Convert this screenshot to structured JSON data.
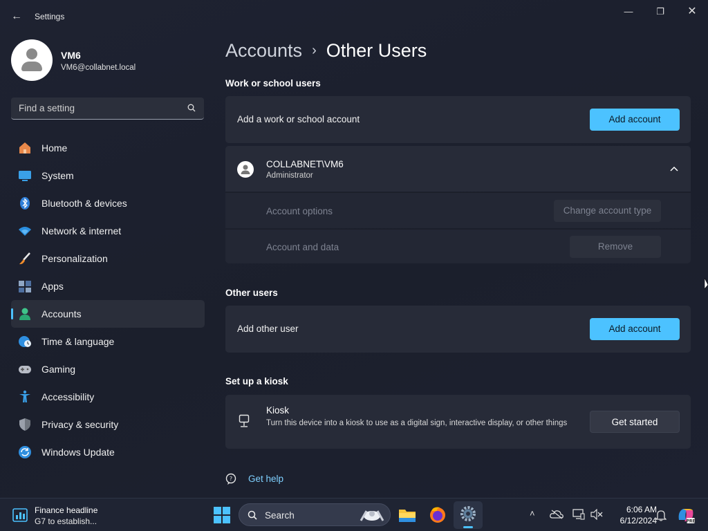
{
  "window": {
    "title": "Settings"
  },
  "profile": {
    "name": "VM6",
    "email": "VM6@collabnet.local"
  },
  "search": {
    "placeholder": "Find a setting"
  },
  "nav": {
    "items": [
      {
        "label": "Home",
        "icon": "home-icon"
      },
      {
        "label": "System",
        "icon": "system-icon"
      },
      {
        "label": "Bluetooth & devices",
        "icon": "bluetooth-icon"
      },
      {
        "label": "Network & internet",
        "icon": "wifi-icon"
      },
      {
        "label": "Personalization",
        "icon": "brush-icon"
      },
      {
        "label": "Apps",
        "icon": "apps-icon"
      },
      {
        "label": "Accounts",
        "icon": "accounts-icon"
      },
      {
        "label": "Time & language",
        "icon": "globe-clock-icon"
      },
      {
        "label": "Gaming",
        "icon": "gamepad-icon"
      },
      {
        "label": "Accessibility",
        "icon": "accessibility-icon"
      },
      {
        "label": "Privacy & security",
        "icon": "shield-icon"
      },
      {
        "label": "Windows Update",
        "icon": "update-icon"
      }
    ],
    "active": "Accounts"
  },
  "breadcrumb": {
    "parent": "Accounts",
    "separator": "›",
    "current": "Other Users"
  },
  "work_school": {
    "heading": "Work or school users",
    "add_text": "Add a work or school account",
    "add_button": "Add account",
    "account": {
      "name": "COLLABNET\\VM6",
      "role": "Administrator",
      "options_label": "Account options",
      "options_button": "Change account type",
      "data_label": "Account and data",
      "data_button": "Remove"
    }
  },
  "other_users": {
    "heading": "Other users",
    "add_text": "Add other user",
    "add_button": "Add account"
  },
  "kiosk": {
    "heading": "Set up a kiosk",
    "title": "Kiosk",
    "description": "Turn this device into a kiosk to use as a digital sign, interactive display, or other things",
    "button": "Get started"
  },
  "help": {
    "label": "Get help"
  },
  "taskbar": {
    "news_title": "Finance headline",
    "news_sub": "G7 to establish...",
    "search_placeholder": "Search",
    "time": "6:06 AM",
    "date": "6/12/2024"
  },
  "colors": {
    "accent": "#4cc2ff",
    "background": "#1e2231",
    "card": "#272b38"
  }
}
